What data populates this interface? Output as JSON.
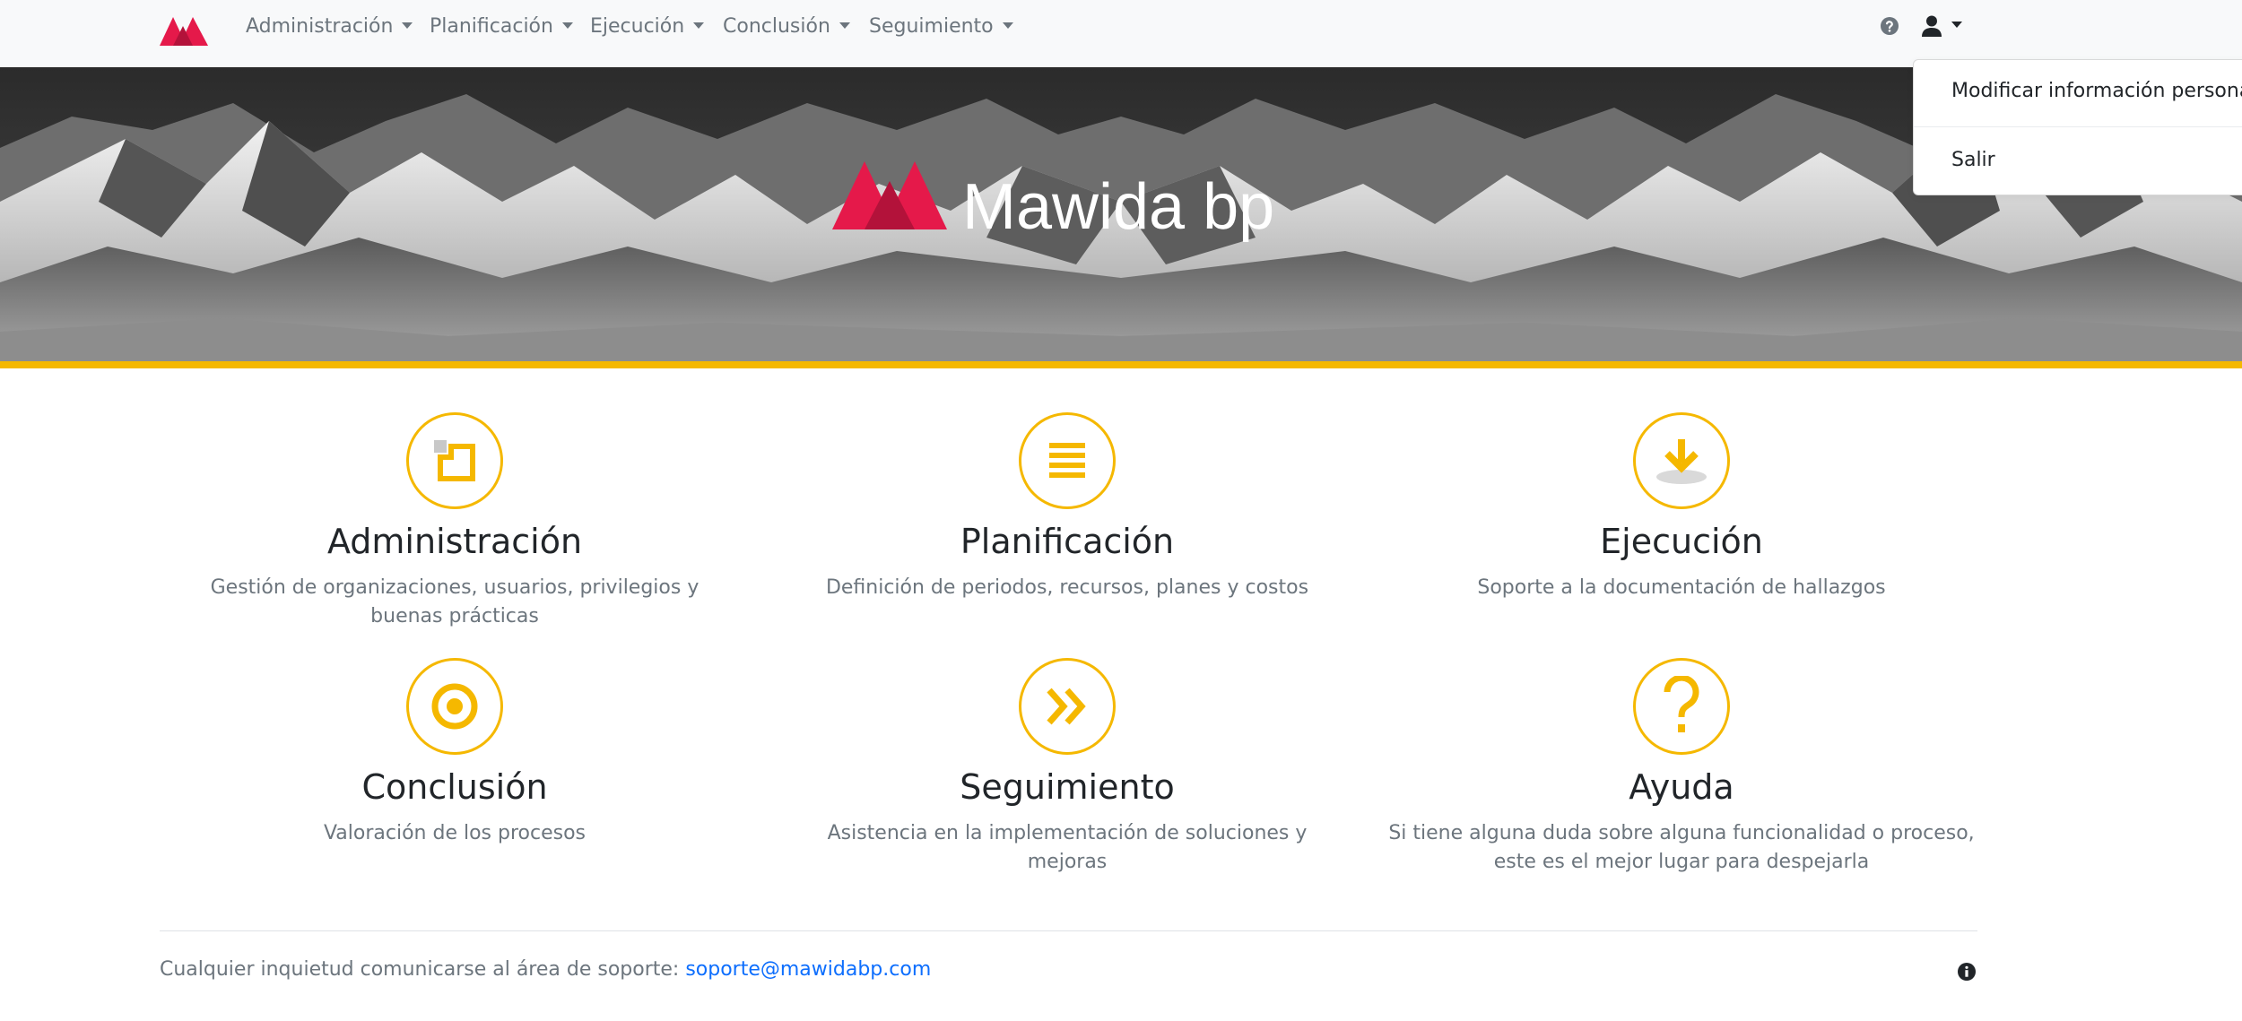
{
  "app": {
    "name": "Mawida bp",
    "brand_colors": {
      "primary": "#e5194a",
      "primary_dark": "#b3123a",
      "accent": "#f5b800",
      "link": "#0d6efd"
    }
  },
  "navbar": {
    "menus": [
      {
        "label": "Administración"
      },
      {
        "label": "Planificación"
      },
      {
        "label": "Ejecución"
      },
      {
        "label": "Conclusión"
      },
      {
        "label": "Seguimiento"
      }
    ],
    "icons": {
      "help": "question-circle-icon",
      "user": "user-icon"
    }
  },
  "user_menu": {
    "items": [
      {
        "label": "Modificar información personal"
      },
      {
        "label": "Salir"
      }
    ]
  },
  "hero": {
    "title": "Mawida bp"
  },
  "features": [
    {
      "icon": "administration-icon",
      "title": "Administración",
      "description": "Gestión de organizaciones, usuarios, privilegios y buenas prácticas"
    },
    {
      "icon": "planning-list-icon",
      "title": "Planificación",
      "description": "Definición de periodos, recursos, planes y costos"
    },
    {
      "icon": "download-arrow-icon",
      "title": "Ejecución",
      "description": "Soporte a la documentación de hallazgos"
    },
    {
      "icon": "target-icon",
      "title": "Conclusión",
      "description": "Valoración de los procesos"
    },
    {
      "icon": "double-chevron-right-icon",
      "title": "Seguimiento",
      "description": "Asistencia en la implementación de soluciones y mejoras"
    },
    {
      "icon": "question-mark-icon",
      "title": "Ayuda",
      "description": "Si tiene alguna duda sobre alguna funcionalidad o proceso, este es el mejor lugar para despejarla"
    }
  ],
  "footer": {
    "text": "Cualquier inquietud comunicarse al área de soporte:",
    "email": "soporte@mawidabp.com"
  }
}
